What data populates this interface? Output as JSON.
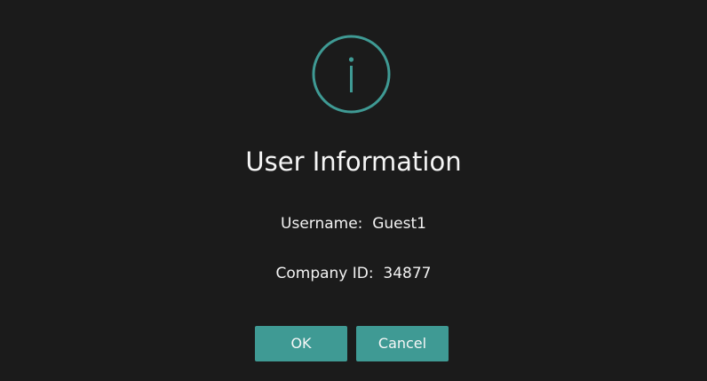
{
  "dialog": {
    "icon": "info-circle-icon",
    "title": "User Information",
    "fields": [
      {
        "label": "Username:",
        "value": "Guest1"
      },
      {
        "label": "Company ID:",
        "value": "34877"
      }
    ],
    "buttons": {
      "ok_label": "OK",
      "cancel_label": "Cancel"
    }
  },
  "colors": {
    "background": "#1b1b1b",
    "accent": "#3f9a94",
    "text": "#f2f2f2"
  }
}
